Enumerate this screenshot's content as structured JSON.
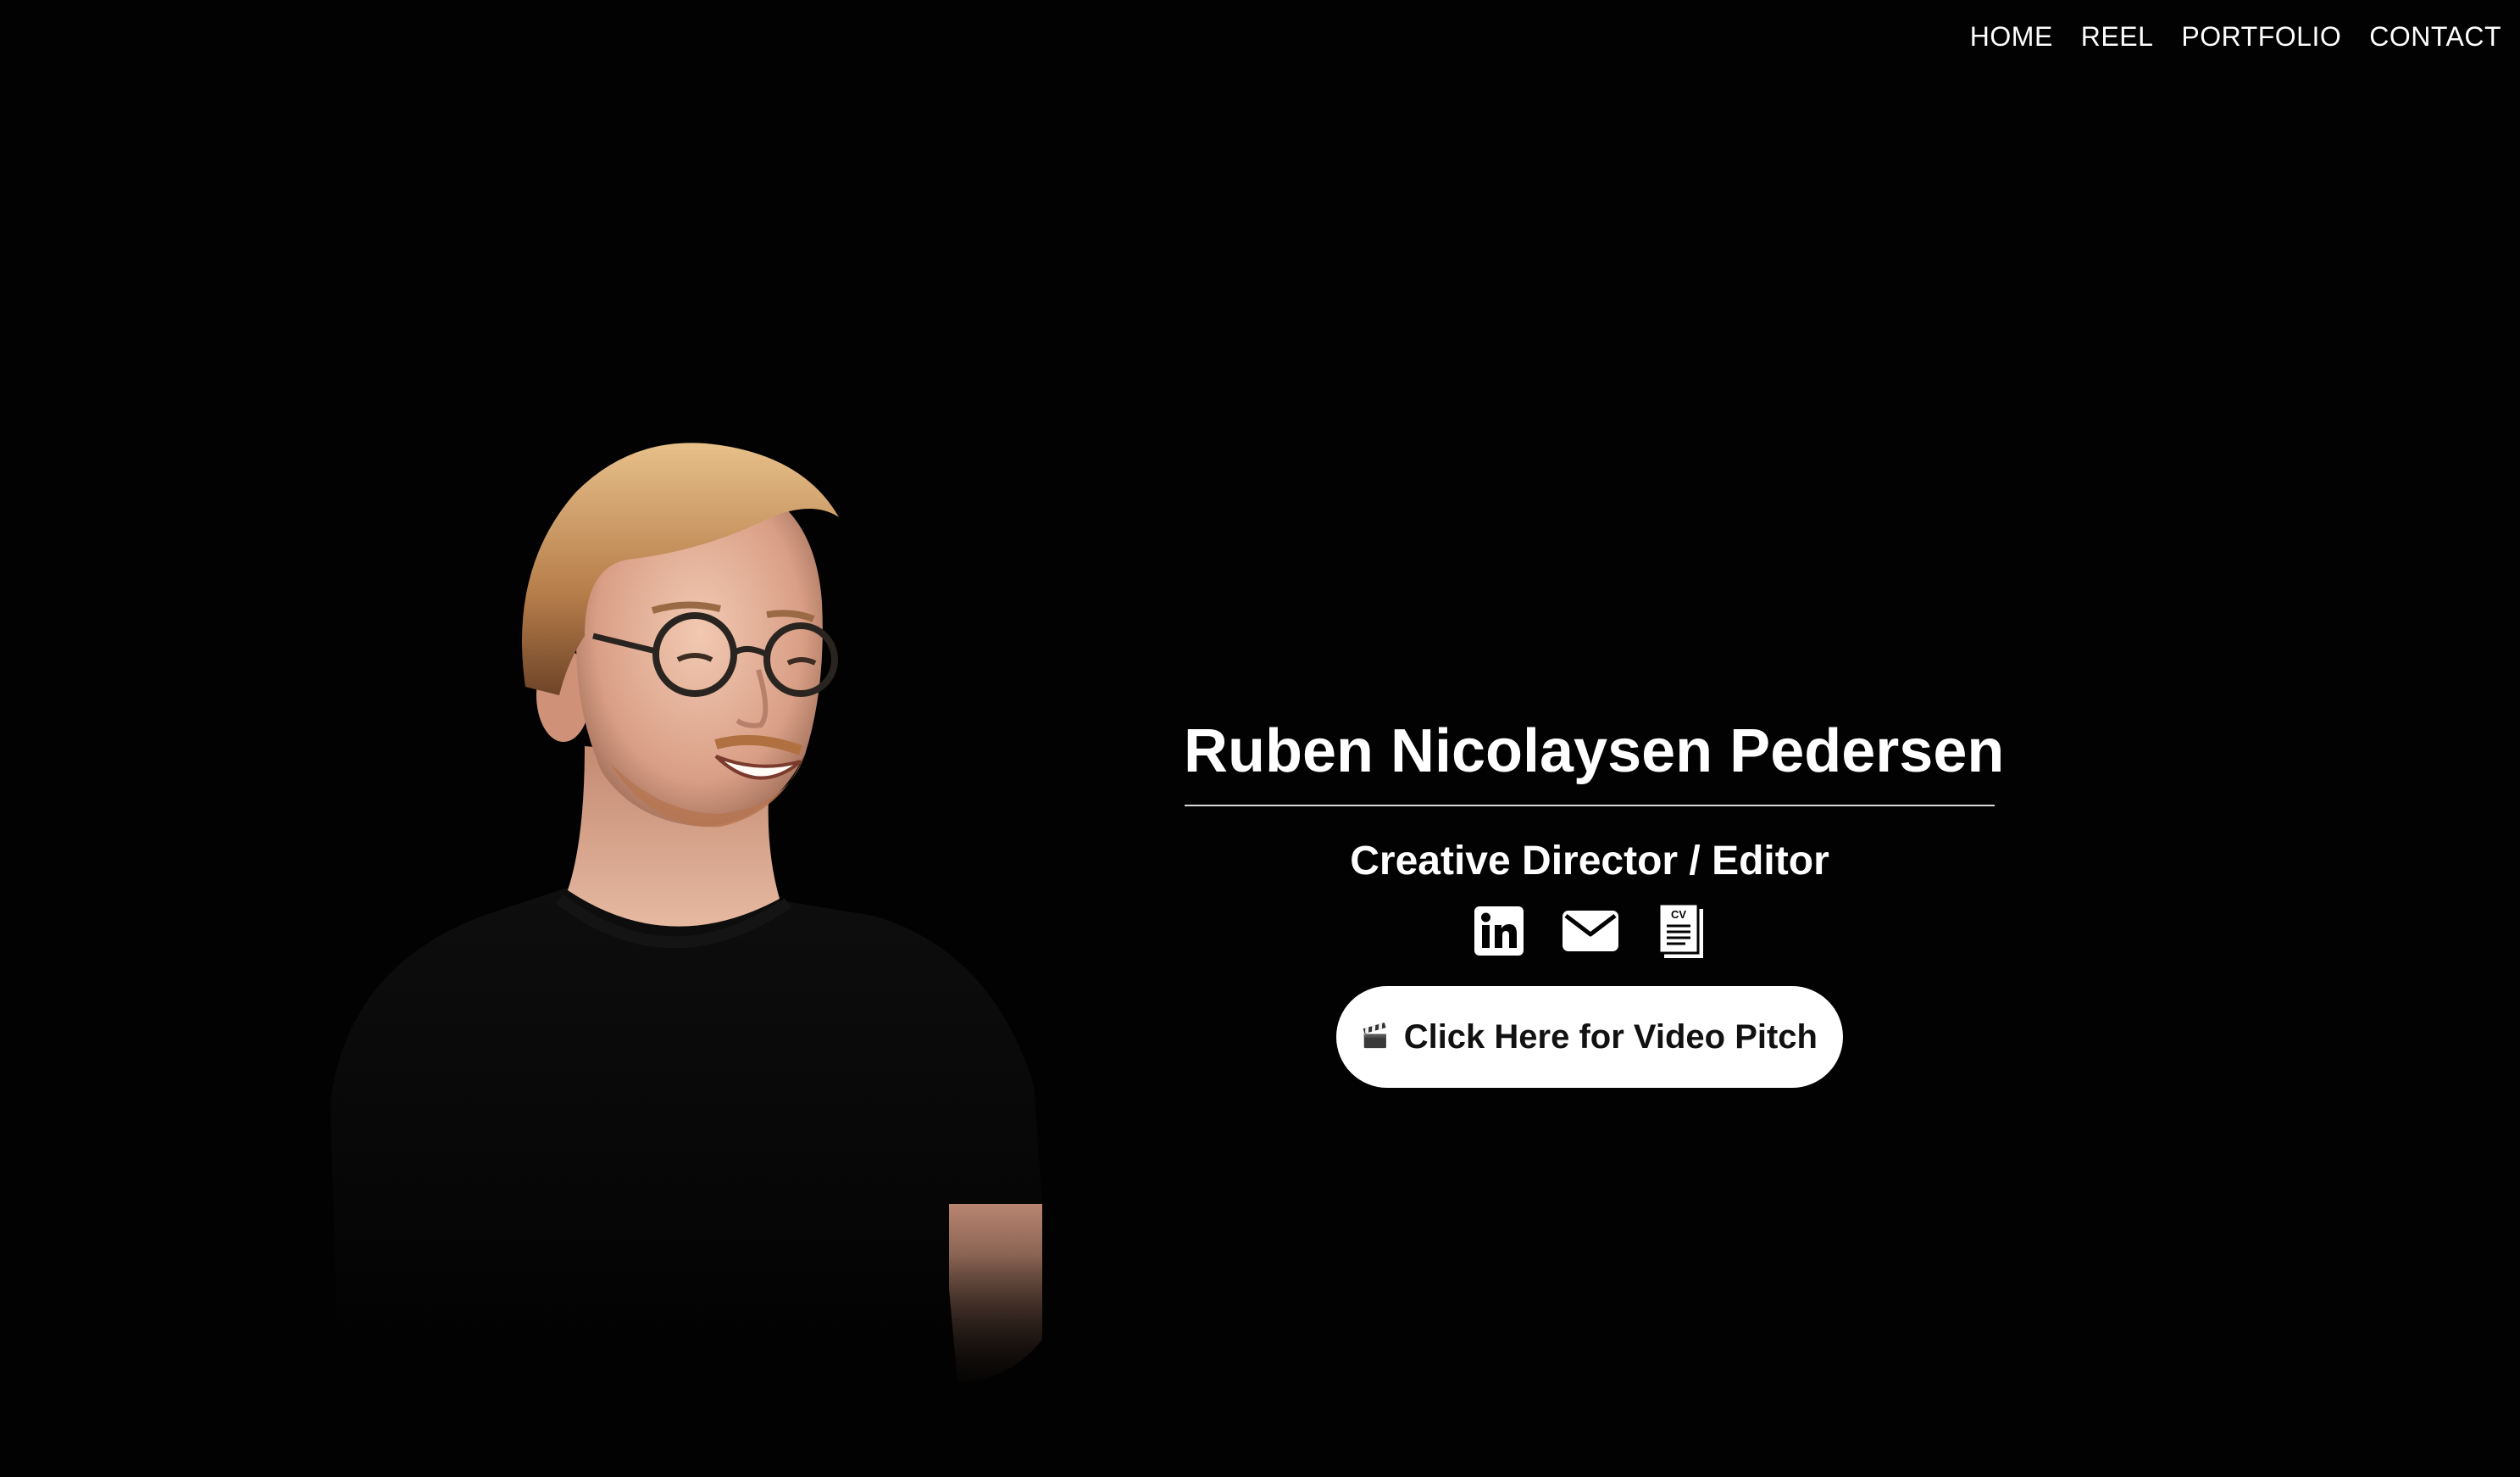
{
  "nav": {
    "items": [
      {
        "label": "HOME"
      },
      {
        "label": "REEL"
      },
      {
        "label": "PORTFOLIO"
      },
      {
        "label": "CONTACT"
      }
    ]
  },
  "hero": {
    "name": "Ruben Nicolaysen Pedersen",
    "title": "Creative Director / Editor",
    "socials": [
      {
        "icon": "linkedin-icon"
      },
      {
        "icon": "mail-icon"
      },
      {
        "icon": "cv-document-icon",
        "label": "CV"
      }
    ],
    "pitch_button": {
      "icon": "clapperboard-icon",
      "label": "Click Here for Video Pitch"
    }
  },
  "colors": {
    "background": "#020202",
    "text": "#ffffff",
    "button_bg": "#ffffff",
    "button_text": "#111111"
  }
}
